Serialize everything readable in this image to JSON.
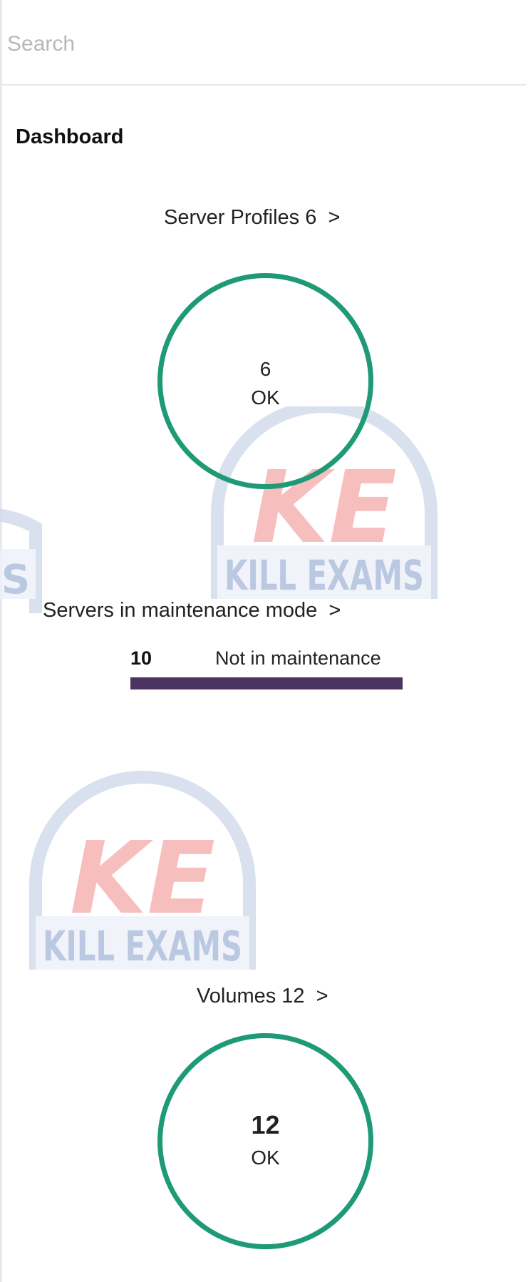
{
  "search": {
    "placeholder": "Search",
    "value": ""
  },
  "page": {
    "title": "Dashboard"
  },
  "server_profiles": {
    "label": "Server Profiles",
    "count": "6",
    "chevron": ">",
    "ring_count": "6",
    "ring_status": "OK",
    "ring_color": "#1f9a76"
  },
  "maintenance": {
    "label": "Servers in maintenance mode",
    "chevron": ">",
    "count": "10",
    "status_label": "Not in maintenance",
    "fill_fraction": 1.0,
    "bar_color": "#4b3560"
  },
  "volumes": {
    "label": "Volumes",
    "count": "12",
    "chevron": ">",
    "ring_count": "12",
    "ring_status": "OK",
    "ring_color": "#1f9a76"
  },
  "watermark": {
    "monogram": "KE",
    "text": "KILL EXAMS",
    "partial_letter": "S"
  },
  "colors": {
    "ok_green": "#1f9a76",
    "maintenance_purple": "#4b3560",
    "watermark_red": "#f28a8a",
    "watermark_blue": "#9fb3d6"
  }
}
